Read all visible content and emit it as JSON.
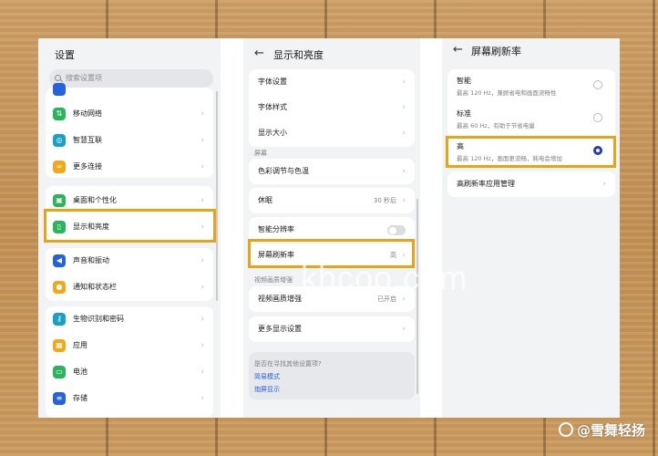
{
  "panel1": {
    "title": "设置",
    "search_placeholder": "搜索设置项",
    "items": [
      {
        "label": "移动网络",
        "color": "#2bb55a",
        "glyph": "⇅",
        "icon": "mobile-network-icon"
      },
      {
        "label": "智慧互联",
        "color": "#1aa0c8",
        "glyph": "◎",
        "icon": "smart-connect-icon"
      },
      {
        "label": "更多连接",
        "color": "#f2a81b",
        "glyph": "∞",
        "icon": "more-connections-icon"
      },
      {
        "label": "桌面和个性化",
        "color": "#2bb55a",
        "glyph": "▣",
        "icon": "desktop-personalize-icon"
      },
      {
        "label": "显示和亮度",
        "color": "#2bb55a",
        "glyph": "▯",
        "icon": "display-brightness-icon"
      },
      {
        "label": "声音和振动",
        "color": "#2462e0",
        "glyph": "◀",
        "icon": "sound-vibration-icon"
      },
      {
        "label": "通知和状态栏",
        "color": "#f2a81b",
        "glyph": "●",
        "icon": "notification-icon"
      },
      {
        "label": "生物识别和密码",
        "color": "#1aa0c8",
        "glyph": "⚷",
        "icon": "biometric-password-icon"
      },
      {
        "label": "应用",
        "color": "#f2a81b",
        "glyph": "▦",
        "icon": "apps-icon"
      },
      {
        "label": "电池",
        "color": "#2bb55a",
        "glyph": "▭",
        "icon": "battery-icon"
      },
      {
        "label": "存储",
        "color": "#2462e0",
        "glyph": "≡",
        "icon": "storage-icon"
      }
    ]
  },
  "panel2": {
    "title": "显示和亮度",
    "font_settings": "字体设置",
    "font_style": "字体样式",
    "display_size": "显示大小",
    "section_screen": "屏幕",
    "color_temp": "色彩调节与色温",
    "sleep": "休眠",
    "sleep_value": "30 秒后",
    "smart_resolution": "智能分辨率",
    "refresh_rate": "屏幕刷新率",
    "refresh_value": "高",
    "section_video": "视频画质增强",
    "video_enhance": "视频画质增强",
    "video_enhance_value": "已开启",
    "more_display": "更多显示设置",
    "suggest_title": "是否在寻找其他设置项?",
    "link_simple": "简易模式",
    "link_notch": "炮屏显示"
  },
  "panel3": {
    "title": "屏幕刷新率",
    "options": [
      {
        "title": "智能",
        "desc": "最高 120 Hz，兼顾省电和画面流畅性",
        "selected": false
      },
      {
        "title": "标准",
        "desc": "最高 60 Hz，有助于节省电量",
        "selected": false
      },
      {
        "title": "高",
        "desc": "最高 120 Hz，画面更流畅，耗电会增加",
        "selected": true
      }
    ],
    "app_manage": "高刷新率应用管理"
  },
  "overlay": {
    "watermark": "khcoo.com",
    "credit": "@雪舞轻扬"
  },
  "colors": {
    "highlight": "#e8a317",
    "radio_on": "#1b3fbf",
    "link": "#2462e0"
  }
}
